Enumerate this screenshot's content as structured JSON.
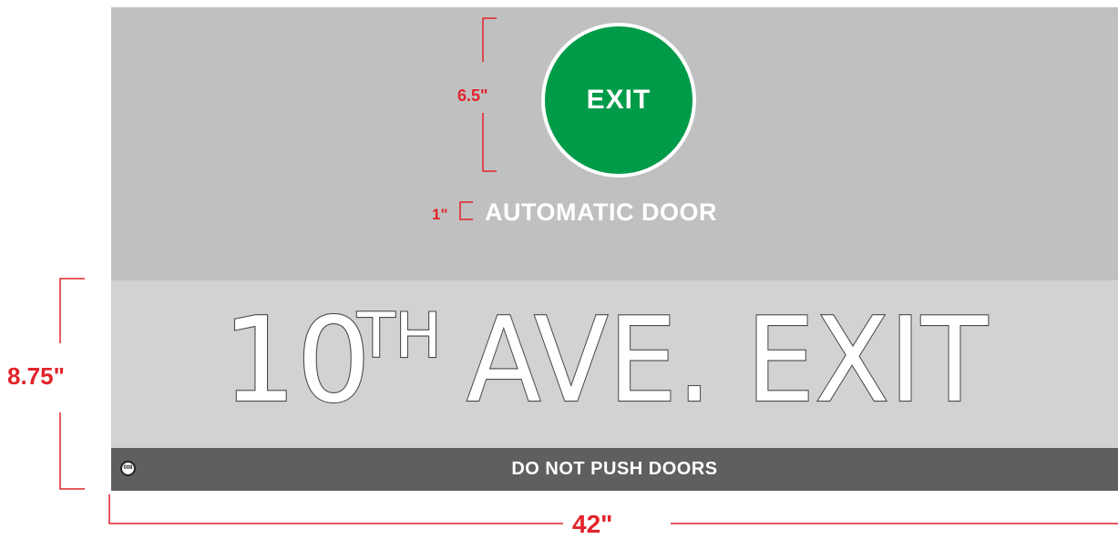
{
  "sign": {
    "exit_button_label": "EXIT",
    "door_label": "AUTOMATIC DOOR",
    "title_main": "10",
    "title_super": "TH",
    "title_rest": "AVE. EXIT",
    "bar_text": "DO NOT PUSH DOORS",
    "logo_text": "008"
  },
  "dimensions": {
    "circle_height": "6.5\"",
    "text_height": "1\"",
    "sign_height": "8.75\"",
    "sign_width": "42\""
  },
  "colors": {
    "top_panel": "#c0c0c0",
    "middle_panel": "#d1d2d4",
    "bottom_bar": "#5e5f61",
    "exit_green": "#009b48",
    "dimension_red": "#e2232a"
  }
}
